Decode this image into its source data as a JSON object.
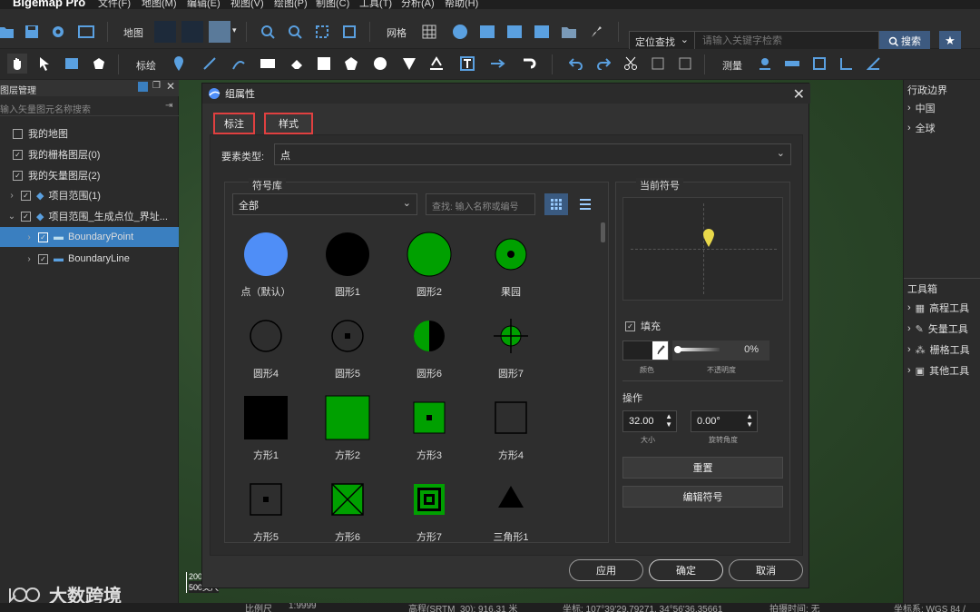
{
  "app": {
    "brand": "Bigemap Pro",
    "menu": [
      "文件(F)",
      "地图(M)",
      "编辑(E)",
      "视图(V)",
      "绘图(P)",
      "制图(C)",
      "工具(T)",
      "分析(A)",
      "帮助(H)"
    ]
  },
  "toolbar1": {
    "map_label": "地图",
    "grid_label": "网格",
    "loc_select": "定位查找",
    "search_placeholder": "请输入关键字检索",
    "search_btn": "搜索"
  },
  "toolbar2": {
    "plot_label": "标绘",
    "measure_label": "测量"
  },
  "left_panel": {
    "title": "图层管理",
    "search_placeholder": "输入矢量图元名称搜索",
    "items": [
      {
        "label": "我的地图",
        "checked": false
      },
      {
        "label": "我的栅格图层(0)",
        "checked": true
      },
      {
        "label": "我的矢量图层(2)",
        "checked": true
      },
      {
        "label": "项目范围(1)",
        "checked": true
      },
      {
        "label": "项目范围_生成点位_界址...",
        "checked": true
      },
      {
        "label": "BoundaryPoint",
        "checked": true
      },
      {
        "label": "BoundaryLine",
        "checked": true
      }
    ]
  },
  "right_panel": {
    "admin_title": "行政边界",
    "admin_items": [
      "中国",
      "全球"
    ],
    "toolbox_title": "工具箱",
    "toolbox_items": [
      "高程工具",
      "矢量工具",
      "栅格工具",
      "其他工具"
    ]
  },
  "dialog": {
    "title": "组属性",
    "tabs": [
      "标注",
      "样式"
    ],
    "feature_type_label": "要素类型:",
    "feature_type_value": "点",
    "library_title": "符号库",
    "library_filter": "全部",
    "library_search_placeholder": "查找: 输入名称或编号",
    "symbols": [
      {
        "name": "点（默认）",
        "kind": "circle-blue"
      },
      {
        "name": "圆形1",
        "kind": "circle-black"
      },
      {
        "name": "圆形2",
        "kind": "circle-green"
      },
      {
        "name": "果园",
        "kind": "orchard"
      },
      {
        "name": "圆形4",
        "kind": "circle-outline"
      },
      {
        "name": "圆形5",
        "kind": "circle-dot"
      },
      {
        "name": "圆形6",
        "kind": "circle-half"
      },
      {
        "name": "圆形7",
        "kind": "circle-cross"
      },
      {
        "name": "方形1",
        "kind": "square-black"
      },
      {
        "name": "方形2",
        "kind": "square-green"
      },
      {
        "name": "方形3",
        "kind": "square-green-dot"
      },
      {
        "name": "方形4",
        "kind": "square-outline"
      },
      {
        "name": "方形5",
        "kind": "square-dot"
      },
      {
        "name": "方形6",
        "kind": "square-x"
      },
      {
        "name": "方形7",
        "kind": "square-concentric"
      },
      {
        "name": "三角形1",
        "kind": "triangle-black"
      }
    ],
    "current_title": "当前符号",
    "fill_label": "填充",
    "fill_checked": true,
    "opacity_value": "0%",
    "color_caption": "颜色",
    "opacity_caption": "不透明度",
    "ops_title": "操作",
    "size_value": "32.00",
    "size_caption": "大小",
    "rotation_value": "0.00°",
    "rotation_caption": "旋转角度",
    "reset_btn": "重置",
    "edit_btn": "编辑符号",
    "apply_btn": "应用",
    "ok_btn": "确定",
    "cancel_btn": "取消"
  },
  "map": {
    "scale_top": "200",
    "scale_bottom": "500英尺",
    "watermark": "大数跨境"
  },
  "status": {
    "scale_label": "比例尺",
    "scale_value": "1:9999",
    "elev": "高程(SRTM_30): 916.31 米",
    "coord": "坐标: 107°39'29.79271, 34°56'36.35661",
    "time": "拍摄时间: 无",
    "crs": "坐标系: WGS 84 /"
  },
  "colors": {
    "accent": "#3d5a80",
    "selected": "#3a7fc0",
    "green": "#00a000",
    "blue": "#4f8ef7",
    "tab_highlight": "#e04040",
    "pin": "#e8d84a"
  }
}
